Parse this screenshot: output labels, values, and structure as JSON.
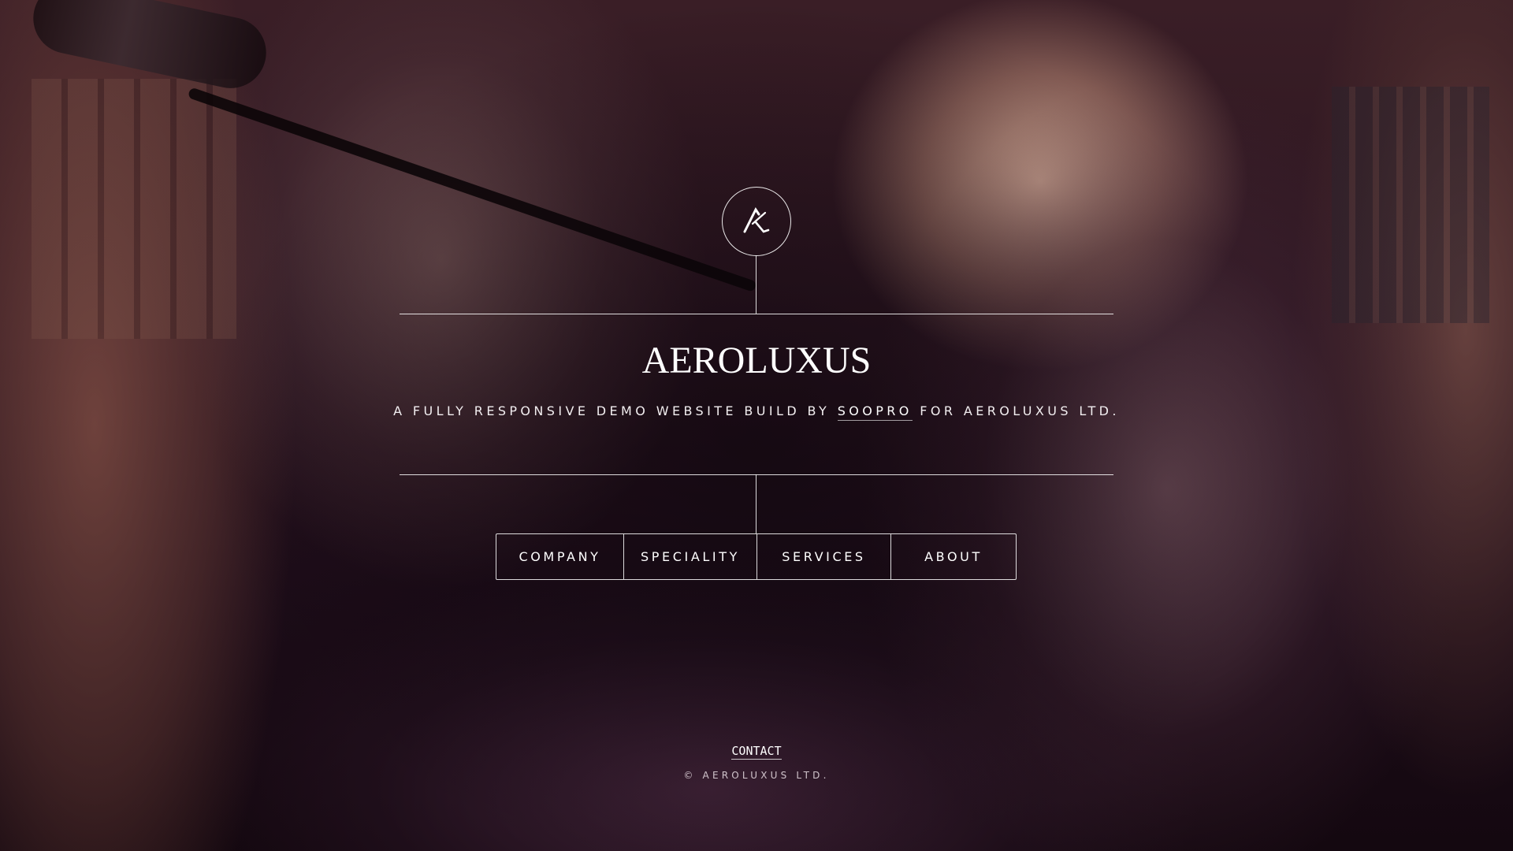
{
  "logo": {
    "icon": "ak-monogram-icon"
  },
  "brand": {
    "name": "AEROLUXUS"
  },
  "tagline": {
    "prefix": "A FULLY RESPONSIVE DEMO WEBSITE BUILD BY ",
    "link": "SOOPRO",
    "suffix": " FOR AEROLUXUS LTD."
  },
  "nav": {
    "items": [
      {
        "label": "COMPANY"
      },
      {
        "label": "SPECIALITY"
      },
      {
        "label": "SERVICES"
      },
      {
        "label": "ABOUT"
      }
    ]
  },
  "footer": {
    "contact": "CONTACT",
    "copyright": "© AEROLUXUS LTD."
  },
  "colors": {
    "text": "#ffffff",
    "lines": "#ffffff",
    "background": "#140810"
  }
}
